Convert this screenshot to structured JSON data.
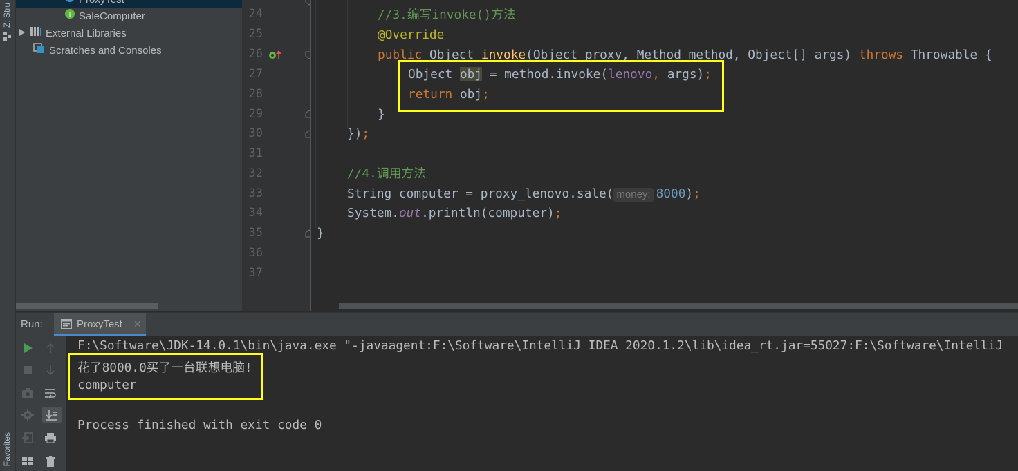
{
  "side_tabs": {
    "structure": "Z: Stru",
    "favorites": ": Favorites"
  },
  "project_tree": {
    "items": [
      {
        "label": "ProxyTest",
        "icon": "class-icon"
      },
      {
        "label": "SaleComputer",
        "icon": "interface-icon"
      },
      {
        "label": "External Libraries",
        "icon": "library-icon"
      },
      {
        "label": "Scratches and Consoles",
        "icon": "scratches-icon"
      }
    ]
  },
  "editor": {
    "lines": [
      {
        "n": "24"
      },
      {
        "n": "25"
      },
      {
        "n": "26"
      },
      {
        "n": "27"
      },
      {
        "n": "28"
      },
      {
        "n": "29"
      },
      {
        "n": "30"
      },
      {
        "n": "31"
      },
      {
        "n": "32"
      },
      {
        "n": "33"
      },
      {
        "n": "34"
      },
      {
        "n": "35"
      },
      {
        "n": "36"
      },
      {
        "n": "37"
      }
    ],
    "code": {
      "l24_comment": "//3.编写invoke()方法",
      "l25_annotation": "@Override",
      "l26_public": "public",
      "l26_type": " Object ",
      "l26_method": "invoke",
      "l26_params": "(Object proxy, Method method, Object[] args) ",
      "l26_throws": "throws",
      "l26_rest": " Throwable {",
      "l27_type": "Object ",
      "l27_var": "obj",
      "l27_mid": " = method.invoke(",
      "l27_field": "lenovo",
      "l27_comma": ",",
      "l27_end": " args)",
      "l27_semi": ";",
      "l28_return": "return",
      "l28_rest": " obj",
      "l28_semi": ";",
      "l29": "}",
      "l30_a": "})",
      "l30_semi": ";",
      "l32_comment": "//4.调用方法",
      "l33_a": "String computer = proxy_lenovo.sale(",
      "l33_hint": "money:",
      "l33_num": "8000",
      "l33_b": ")",
      "l33_semi": ";",
      "l34_a": "System.",
      "l34_field": "out",
      "l34_b": ".println(computer)",
      "l34_semi": ";",
      "l35": "}"
    }
  },
  "run_panel": {
    "label": "Run:",
    "tab": "ProxyTest",
    "console": [
      "F:\\Software\\JDK-14.0.1\\bin\\java.exe \"-javaagent:F:\\Software\\IntelliJ IDEA 2020.1.2\\lib\\idea_rt.jar=55027:F:\\Software\\IntelliJ",
      "花了8000.0买了一台联想电脑!",
      "computer",
      "",
      "Process finished with exit code 0"
    ]
  },
  "colors": {
    "highlight_box": "#ffff1a",
    "keyword": "#cc7832",
    "comment": "#629755",
    "annotation": "#bbb529"
  }
}
